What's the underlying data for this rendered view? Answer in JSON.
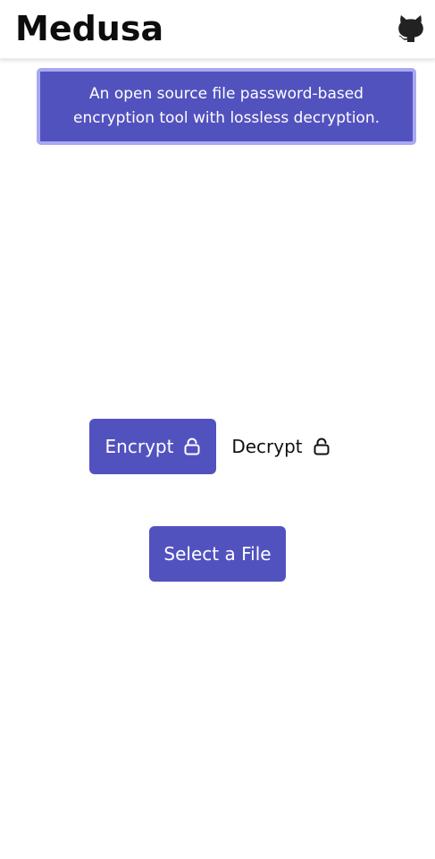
{
  "app": {
    "title": "Medusa"
  },
  "header": {
    "github_icon": "github-icon"
  },
  "banner": {
    "text": "An open source file password-based encryption tool with lossless decryption."
  },
  "modes": {
    "encrypt_label": "Encrypt",
    "decrypt_label": "Decrypt",
    "selected": "Encrypt",
    "lock_icon": "lock-open-icon"
  },
  "actions": {
    "select_file_label": "Select a File"
  },
  "colors": {
    "accent": "#5252bf",
    "banner_border": "#a8a8f0",
    "background": "#ffffff"
  }
}
